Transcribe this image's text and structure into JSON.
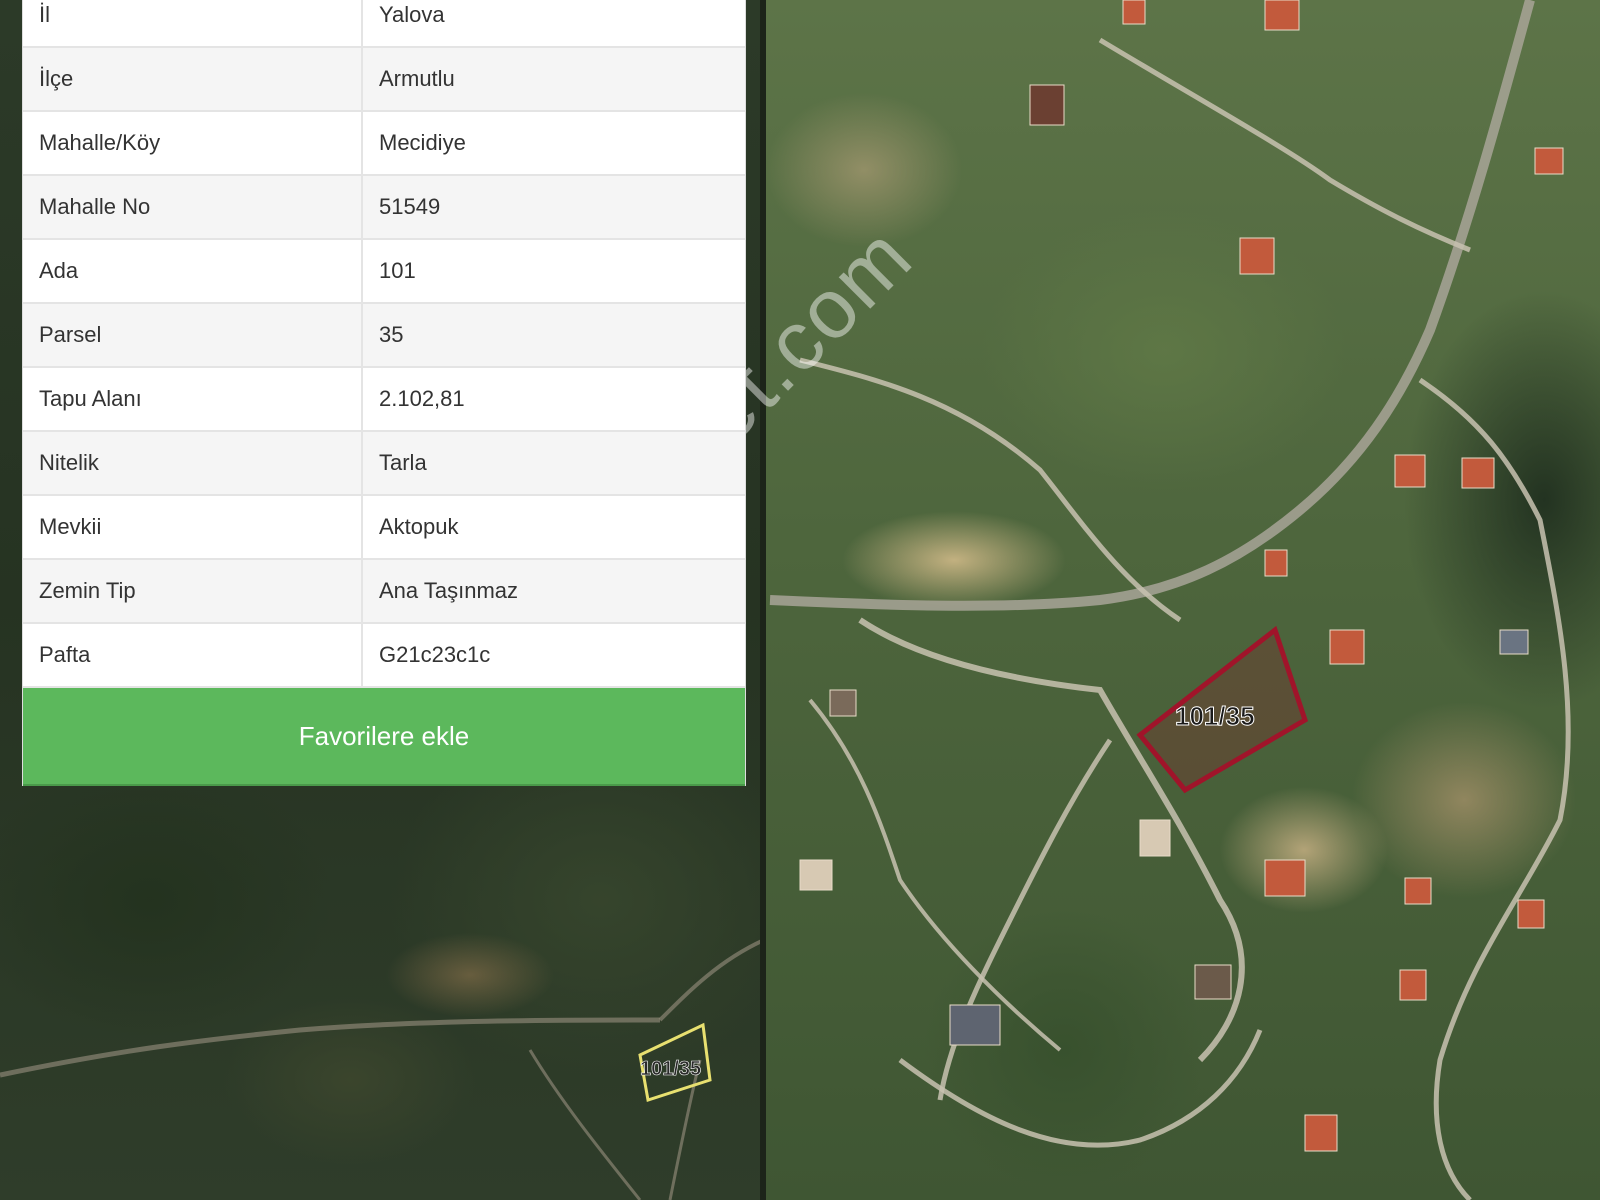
{
  "property": {
    "rows": [
      {
        "label": "İl",
        "value": "Yalova"
      },
      {
        "label": "İlçe",
        "value": "Armutlu"
      },
      {
        "label": "Mahalle/Köy",
        "value": "Mecidiye"
      },
      {
        "label": "Mahalle No",
        "value": "51549"
      },
      {
        "label": "Ada",
        "value": "101"
      },
      {
        "label": "Parsel",
        "value": "35"
      },
      {
        "label": "Tapu Alanı",
        "value": "2.102,81"
      },
      {
        "label": "Nitelik",
        "value": "Tarla"
      },
      {
        "label": "Mevkii",
        "value": "Aktopuk"
      },
      {
        "label": "Zemin Tip",
        "value": "Ana Taşınmaz"
      },
      {
        "label": "Pafta",
        "value": "G21c23c1c"
      }
    ],
    "favorite_button": "Favorilere ekle"
  },
  "map": {
    "parcel_label_large": "101/35",
    "parcel_label_small": "101/35",
    "watermark": "emlakjet.com"
  },
  "colors": {
    "button_green": "#5cb85c",
    "parcel_outline_large": "#a0142a",
    "parcel_outline_small": "#e8e070"
  }
}
